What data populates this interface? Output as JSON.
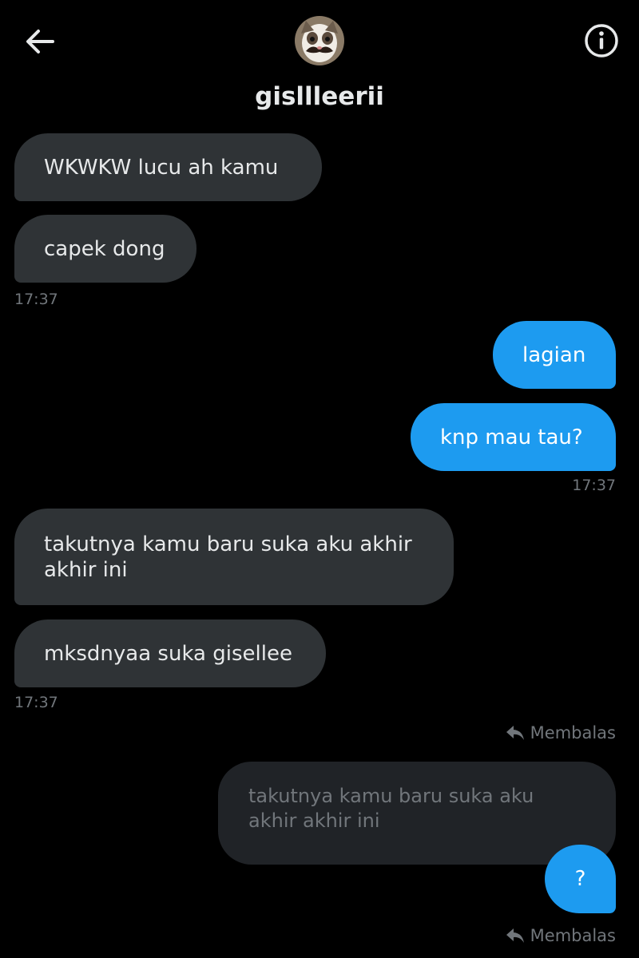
{
  "header": {
    "username": "gisllleerii",
    "back_icon": "arrow-left-icon",
    "info_icon": "info-icon"
  },
  "messages": [
    {
      "text": "WKWKW lucu ah kamu"
    },
    {
      "text": "capek dong"
    },
    {
      "text": "lagian"
    },
    {
      "text": "knp mau tau?"
    },
    {
      "text": "takutnya kamu baru suka aku akhir akhir ini"
    },
    {
      "text": "mksdnyaa suka gisellee"
    },
    {
      "text": "?"
    }
  ],
  "timestamps": [
    "17:37",
    "17:37",
    "17:37"
  ],
  "replies": [
    {
      "label": "Membalas"
    },
    {
      "label": "Membalas"
    }
  ],
  "quoted": {
    "text": "takutnya kamu baru suka aku akhir akhir ini"
  },
  "colors": {
    "background": "#000000",
    "incoming_bubble": "#2f3336",
    "outgoing_bubble": "#1d9bf0",
    "muted_text": "#71767b"
  }
}
